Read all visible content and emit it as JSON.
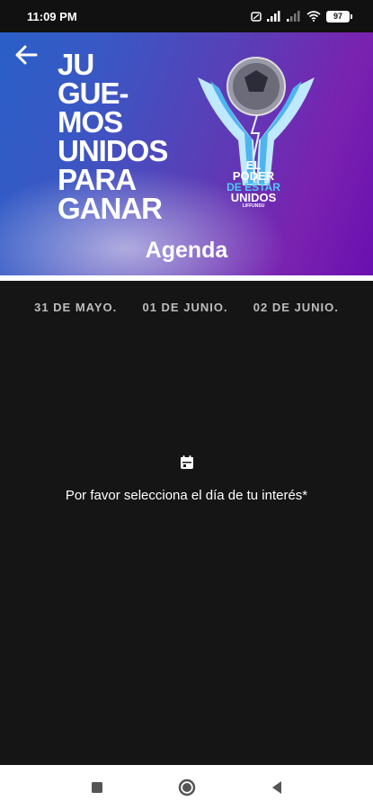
{
  "status_bar": {
    "time": "11:09 PM",
    "battery": "97"
  },
  "header": {
    "headline": "JU\nGUE-\nMOS\nUNIDOS\nPARA\nGANAR",
    "logo": {
      "line1": "EL PODER",
      "line2": "DE ESTAR",
      "line3": "UNIDOS",
      "line4": "LIFFUNSU"
    },
    "title": "Agenda",
    "back_icon": "arrow-left-icon"
  },
  "date_tabs": [
    {
      "label": "31 DE MAYO."
    },
    {
      "label": "01 DE JUNIO."
    },
    {
      "label": "02 DE JUNIO."
    }
  ],
  "empty_state": {
    "icon": "calendar-icon",
    "message": "Por favor selecciona el día de tu interés*"
  },
  "nav_bar": {
    "recents_icon": "square-icon",
    "home_icon": "circle-icon",
    "back_icon": "triangle-back-icon"
  },
  "colors": {
    "background": "#151515",
    "banner_start": "#2a5fc8",
    "banner_end": "#7a22b0",
    "accent": "#4cc9f0"
  }
}
